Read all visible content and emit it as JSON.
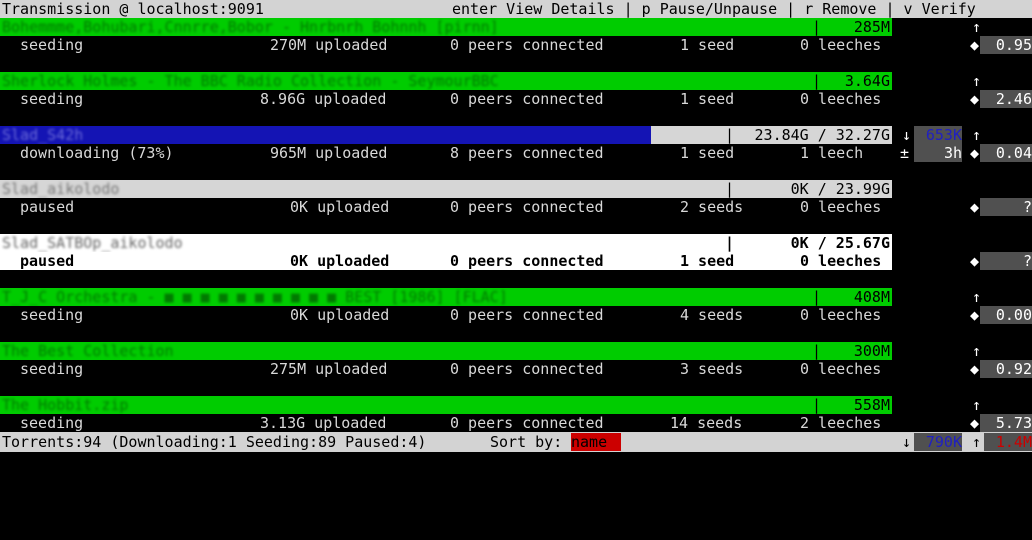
{
  "header": {
    "title": "Transmission @ localhost:9091",
    "help": "enter View Details | p Pause/Unpause | r Remove | v Verify"
  },
  "torrents": [
    {
      "name": "Bohemmme,Bohubari,Cnnrre,Bobor - Hnrbnrh Bohnnh [pirnn]",
      "size": "285M",
      "status": "seeding",
      "uploaded": "270M uploaded",
      "peers": "0 peers connected",
      "seeds": "1 seed",
      "leeches": "0 leeches",
      "up_arrow": "↑",
      "down_arrow": "◆",
      "ratio": "0.95"
    },
    {
      "name": "Sherlock Holmes - The BBC Radio Collection - SeymourBBC",
      "size": "3.64G",
      "status": "seeding",
      "uploaded": "8.96G uploaded",
      "peers": "0 peers connected",
      "seeds": "1 seed",
      "leeches": "0 leeches",
      "up_arrow": "↑",
      "down_arrow": "◆",
      "ratio": "2.46"
    },
    {
      "name": "Slad_S42h",
      "size": "23.84G / 32.27G",
      "status": "downloading (73%)",
      "uploaded": "965M uploaded",
      "peers": "8 peers connected",
      "seeds": "1 seed",
      "leeches": "1 leech",
      "progress": 0.73,
      "down_marker": "↓",
      "down_rate": "653K",
      "eta_marker": "±",
      "eta": "3h",
      "up_arrow": "↑",
      "down_arrow": "◆",
      "ratio": "0.04"
    },
    {
      "name": "Slad_aikolodo",
      "size": "0K / 23.99G",
      "status": "paused",
      "uploaded": "0K uploaded",
      "peers": "0 peers connected",
      "seeds": "2 seeds",
      "leeches": "0 leeches",
      "down_arrow": "◆",
      "ratio": "?"
    },
    {
      "name": "Slad_SATBOp_aikolodo",
      "size": "0K / 25.67G",
      "status": "paused",
      "uploaded": "0K uploaded",
      "peers": "0 peers connected",
      "seeds": "1 seed",
      "leeches": "0 leeches",
      "down_arrow": "◆",
      "ratio": "?"
    },
    {
      "name": "T_J_C Orchestra - ■ ■ ■ ■ ■ ■ ■ ■ ■ ■ BEST [1986] [FLAC]",
      "size": "408M",
      "status": "seeding",
      "uploaded": "0K uploaded",
      "peers": "0 peers connected",
      "seeds": "4 seeds",
      "leeches": "0 leeches",
      "up_arrow": "↑",
      "down_arrow": "◆",
      "ratio": "0.00"
    },
    {
      "name": "The Best Collection",
      "size": "300M",
      "status": "seeding",
      "uploaded": "275M uploaded",
      "peers": "0 peers connected",
      "seeds": "3 seeds",
      "leeches": "0 leeches",
      "up_arrow": "↑",
      "down_arrow": "◆",
      "ratio": "0.92"
    },
    {
      "name": "The Hobbit.zip",
      "size": "558M",
      "status": "seeding",
      "uploaded": "3.13G uploaded",
      "peers": "0 peers connected",
      "seeds": "14 seeds",
      "leeches": "2 leeches",
      "up_arrow": "↑",
      "down_arrow": "◆",
      "ratio": "5.73"
    }
  ],
  "footer": {
    "summary": "Torrents:94 (Downloading:1 Seeding:89 Paused:4)",
    "sort_label": "Sort by:",
    "sort_value": "name",
    "down_marker": "↓",
    "down_rate": "790K",
    "up_marker": "↑",
    "up_rate": "1.4M"
  },
  "colors": {
    "seeding_bar": "#00cc00",
    "download_bar": "#1414b4",
    "paused_bar": "#d6d6d6",
    "selected_bar": "#ffffff",
    "header_bg": "#d3d3d3",
    "ratio_bg": "#505050",
    "sort_highlight": "#cc0000",
    "down_rate": "#2020c0",
    "up_rate": "#cc0000"
  }
}
